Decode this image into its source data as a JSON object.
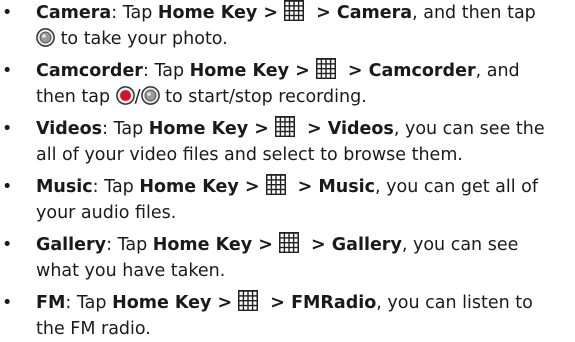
{
  "common": {
    "tap": "Tap ",
    "home_key": "Home Key >",
    "colon": ":",
    "bullet": "•",
    "slash": "/",
    "colors": {
      "text": "#1a1a1a",
      "icon_dark": "#222222",
      "rec_red": "#d8102a"
    },
    "icons": {
      "apps": "apps-grid-icon",
      "shutter": "camera-shutter-icon",
      "record": "record-icon"
    }
  },
  "items": [
    {
      "title": "Camera",
      "target": " > Camera",
      "after": ", and then tap",
      "line2": " to take your photo."
    },
    {
      "title": "Camcorder",
      "target": " > Camcorder",
      "after": ", and",
      "line2_pre": "then tap ",
      "line2": " to start/stop recording."
    },
    {
      "title": "Videos",
      "target": " > Videos",
      "after": ", you can see the",
      "line2": "all of your video files and select to browse them."
    },
    {
      "title": "Music",
      "target": " > Music",
      "after": ", you can get all of",
      "line2": "your audio files."
    },
    {
      "title": "Gallery",
      "target": " > Gallery",
      "after": ", you can see",
      "line2": "what you have taken."
    },
    {
      "title": "FM",
      "target": " > FMRadio",
      "after": ", you can listen to",
      "line2": "the FM radio."
    }
  ]
}
